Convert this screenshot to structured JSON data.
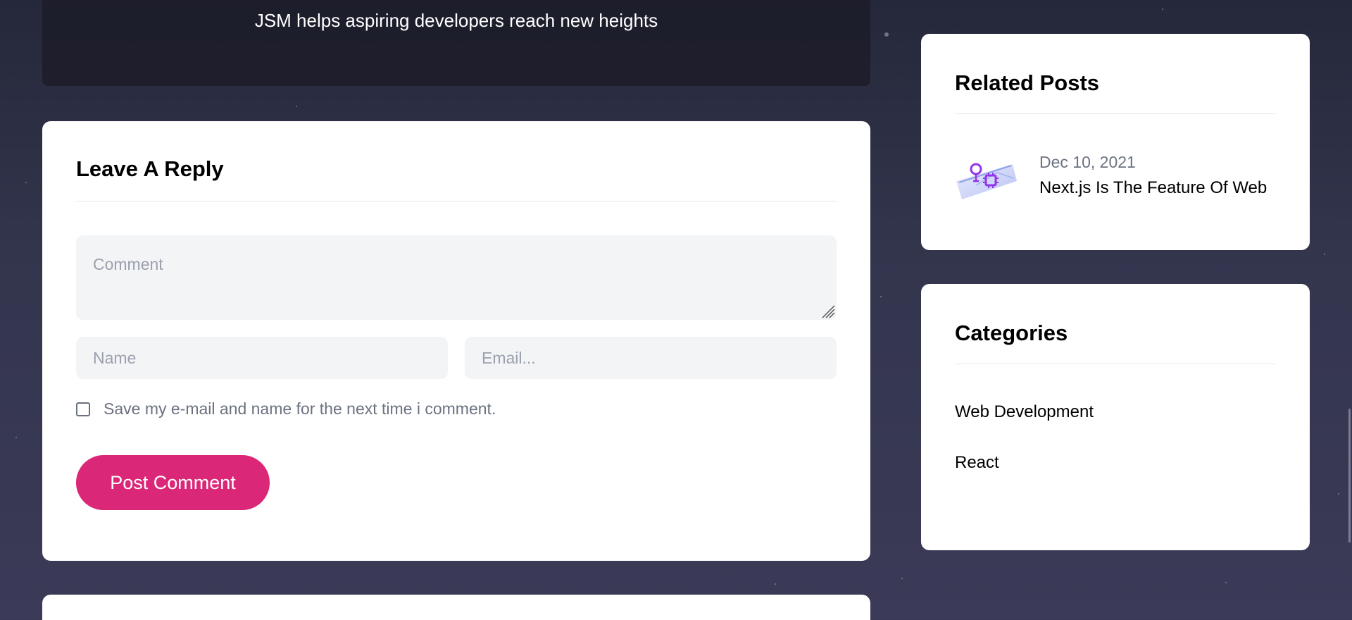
{
  "author": {
    "bio": "JSM helps aspiring developers reach new heights"
  },
  "reply_form": {
    "title": "Leave A Reply",
    "comment_placeholder": "Comment",
    "comment_value": "",
    "name_placeholder": "Name",
    "name_value": "",
    "email_placeholder": "Email...",
    "email_value": "",
    "save_label": "Save my e-mail and name for the next time i comment.",
    "save_checked": false,
    "submit_label": "Post Comment",
    "accent_color": "#db2777"
  },
  "related_posts": {
    "title": "Related Posts",
    "items": [
      {
        "date": "Dec 10, 2021",
        "title": "Next.js Is The Feature Of Web",
        "thumbnail_icon": "chip-lightbulb-illustration"
      }
    ]
  },
  "categories": {
    "title": "Categories",
    "items": [
      {
        "label": "Web Development"
      },
      {
        "label": "React"
      }
    ]
  }
}
